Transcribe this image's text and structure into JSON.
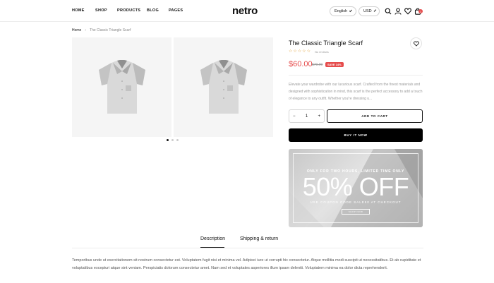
{
  "header": {
    "nav": [
      "HOME",
      "SHOP",
      "PRODUCTS",
      "BLOG",
      "PAGES"
    ],
    "logo": "netro",
    "language": "English",
    "currency": "USD",
    "cart_count": "1",
    "icons": [
      "search-icon",
      "user-icon",
      "heart-icon",
      "bag-icon"
    ]
  },
  "breadcrumb": {
    "home": "Home",
    "current": "The Classic Triangle Scarf"
  },
  "gallery": {
    "dots": 3,
    "active_dot": 1
  },
  "product": {
    "title": "The Classic Triangle Scarf",
    "reviews": "No reviews",
    "price": "$60.00",
    "old_price": "$70.00",
    "save_badge": "SAVE 14%",
    "description": "Elevate your wardrobe with our luxurious scarf. Crafted from the finest materials and designed with sophistication in mind, this scarf is the perfect accessory to add a touch of elegance to any outfit. Whether you're dressing u...",
    "quantity": "1",
    "add_to_cart": "ADD TO CART",
    "buy_now": "BUY IT NOW"
  },
  "promo": {
    "top": "ONLY FOR TWO HOURS, LIMITED TIME ONLY",
    "big": "50% OFF",
    "code": "USE COUPON CODE SALE50 AT CHECKOUT",
    "button": "SHOP NOW"
  },
  "tabs": {
    "description": "Description",
    "shipping": "Shipping & return"
  },
  "content": {
    "text": "Temporibus unde ut exercitationem sit nostrum consectetur est. Voluptatem fugit nisi et minima vel. Adipisci iure ut corrupti hic consectetur. Atque mollitia modi suscipit ut necessitatibus. Et ab cupiditate et voluptatibus excepturi atque sint veniam. Perspiciatis dolorum consectetur amet. Nam sed et voluptates asperiores illum ipsam deleniti. Voluptatem minima ea dolor dicta reprehenderit."
  }
}
